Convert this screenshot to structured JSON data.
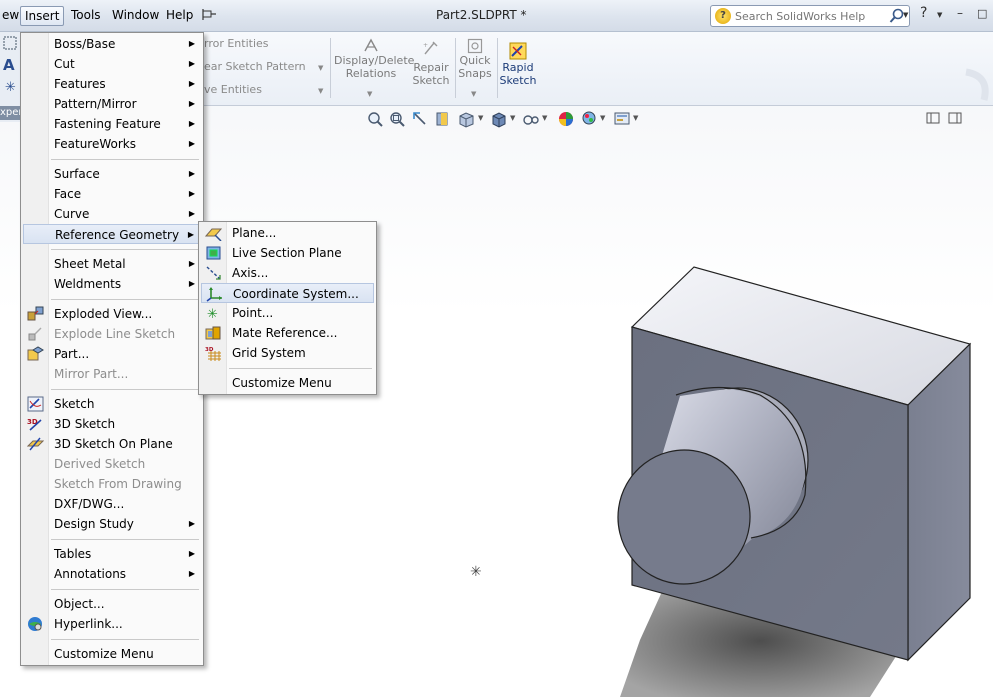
{
  "menubar": {
    "items": [
      {
        "label": "ew"
      },
      {
        "label": "Insert"
      },
      {
        "label": "Tools"
      },
      {
        "label": "Window"
      },
      {
        "label": "Help"
      }
    ]
  },
  "title": "Part2.SLDPRT *",
  "search": {
    "placeholder": "Search SolidWorks Help"
  },
  "toolbar": {
    "partial_items": [
      "rror Entities",
      "ear Sketch Pattern",
      "ve Entities"
    ],
    "display_delete_relations": [
      "Display/Delete",
      "Relations"
    ],
    "repair_sketch": [
      "Repair",
      "Sketch"
    ],
    "quick_snaps": [
      "Quick",
      "Snaps"
    ],
    "rapid_sketch": [
      "Rapid",
      "Sketch"
    ],
    "fm_tab_fragment": "xper"
  },
  "insert_menu": {
    "items": [
      {
        "label": "Boss/Base",
        "submenu": true
      },
      {
        "label": "Cut",
        "submenu": true
      },
      {
        "label": "Features",
        "submenu": true
      },
      {
        "label": "Pattern/Mirror",
        "submenu": true
      },
      {
        "label": "Fastening Feature",
        "submenu": true
      },
      {
        "label": "FeatureWorks",
        "submenu": true
      },
      {
        "label": "Surface",
        "submenu": true
      },
      {
        "label": "Face",
        "submenu": true
      },
      {
        "label": "Curve",
        "submenu": true
      },
      {
        "label": "Reference Geometry",
        "submenu": true
      },
      {
        "label": "Sheet Metal",
        "submenu": true
      },
      {
        "label": "Weldments",
        "submenu": true
      },
      {
        "label": "Exploded View...",
        "icon": "exploded-view-icon"
      },
      {
        "label": "Explode Line Sketch",
        "icon": "explode-line-sketch-icon",
        "disabled": true
      },
      {
        "label": "Part...",
        "icon": "part-icon"
      },
      {
        "label": "Mirror Part...",
        "disabled": true
      },
      {
        "label": "Sketch",
        "icon": "sketch-icon"
      },
      {
        "label": "3D Sketch",
        "icon": "3d-sketch-icon"
      },
      {
        "label": "3D Sketch On Plane",
        "icon": "3d-sketch-on-plane-icon"
      },
      {
        "label": "Derived Sketch",
        "disabled": true
      },
      {
        "label": "Sketch From Drawing",
        "disabled": true
      },
      {
        "label": "DXF/DWG..."
      },
      {
        "label": "Design Study",
        "submenu": true
      },
      {
        "label": "Tables",
        "submenu": true
      },
      {
        "label": "Annotations",
        "submenu": true
      },
      {
        "label": "Object..."
      },
      {
        "label": "Hyperlink...",
        "icon": "hyperlink-icon"
      },
      {
        "label": "Customize Menu"
      }
    ]
  },
  "reference_geometry_menu": {
    "items": [
      {
        "label": "Plane...",
        "icon": "plane-icon"
      },
      {
        "label": "Live Section Plane",
        "icon": "live-section-plane-icon"
      },
      {
        "label": "Axis...",
        "icon": "axis-icon"
      },
      {
        "label": "Coordinate System...",
        "icon": "coordinate-system-icon",
        "highlighted": true
      },
      {
        "label": "Point...",
        "icon": "point-icon"
      },
      {
        "label": "Mate Reference...",
        "icon": "mate-reference-icon"
      },
      {
        "label": "Grid System",
        "icon": "grid-system-icon"
      },
      {
        "label": "Customize Menu"
      }
    ]
  },
  "colors": {
    "accent": "#4a6fa5",
    "model_face_front": "#6e7384",
    "model_face_side": "#7c8193",
    "model_face_top": "#e7e8ee"
  }
}
